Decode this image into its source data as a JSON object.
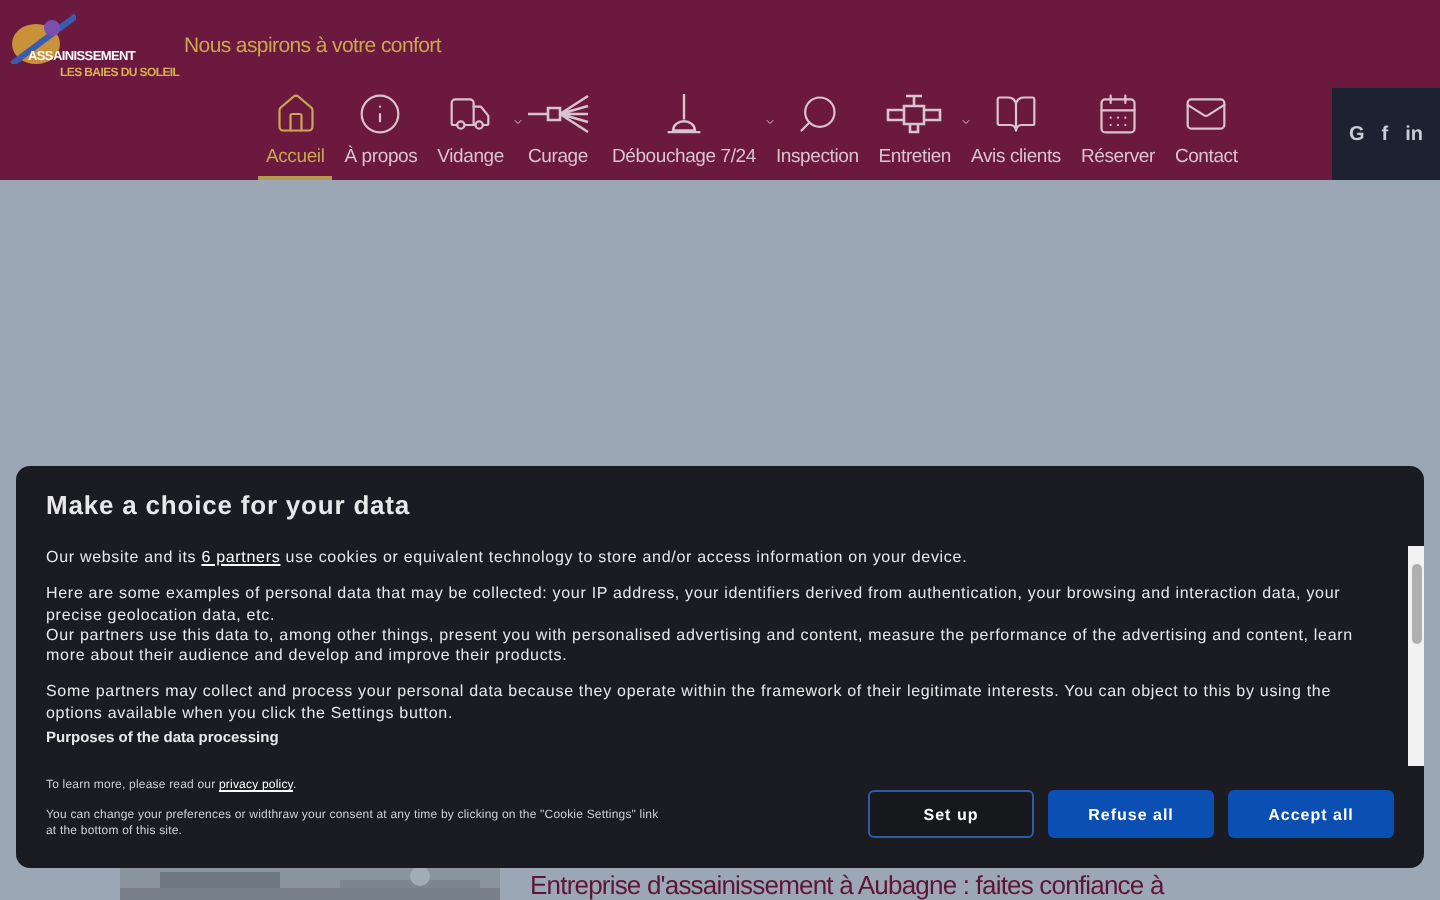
{
  "header": {
    "logo": {
      "line_1": "ASSAINISSEMENT",
      "line_2": "LES BAIES DU SOLEIL"
    },
    "tagline": "Nous aspirons à votre confort",
    "nav": [
      {
        "label": "Accueil",
        "kind": "home",
        "selected": true,
        "dropdown": false
      },
      {
        "label": "À propos",
        "kind": "info",
        "selected": false,
        "dropdown": false
      },
      {
        "label": "Vidange",
        "kind": "truck",
        "selected": false,
        "dropdown": true
      },
      {
        "label": "Curage",
        "kind": "spray",
        "selected": false,
        "dropdown": false
      },
      {
        "label": "Débouchage 7/24",
        "kind": "plunger",
        "selected": false,
        "dropdown": true
      },
      {
        "label": "Inspection",
        "kind": "search",
        "selected": false,
        "dropdown": false
      },
      {
        "label": "Entretien",
        "kind": "valve",
        "selected": false,
        "dropdown": true
      },
      {
        "label": "Avis clients",
        "kind": "book",
        "selected": false,
        "dropdown": false
      },
      {
        "label": "Réserver",
        "kind": "calendar",
        "selected": false,
        "dropdown": false
      },
      {
        "label": "Contact",
        "kind": "mail",
        "selected": false,
        "dropdown": false
      }
    ],
    "social": [
      {
        "label": "G"
      },
      {
        "label": "f"
      },
      {
        "label": "in"
      }
    ]
  },
  "content": {
    "heading": "Entreprise d'assainissement à Aubagne : faites confiance à"
  },
  "consent": {
    "title": "Make a choice for your data",
    "paragraphs": [
      {
        "before": "Our website and its ",
        "link": "6 partners",
        "after": " use cookies or equivalent technology to store and/or access information on your device."
      },
      {
        "before": "Here are some examples of personal data that may be collected: your IP address, your identifiers derived from authentication, your browsing and interaction data, your precise geolocation data, etc.\nOur partners use this data to, among other things, present you with personalised advertising and content, measure the performance of the advertising and content, learn more about their audience and develop and improve their products."
      },
      {
        "before": "Some partners may collect and process your personal data because they operate within the framework of their legitimate interests. You can object to this by using the options available when you click the Settings button."
      }
    ],
    "section_title": "Purposes of the data processing",
    "learn_more": {
      "before": "To learn more, please read our ",
      "link": "privacy policy",
      "after": "."
    },
    "footnote": "You can change your preferences or widthraw your consent at any time by clicking on the \"Cookie Settings\" link at the bottom of this site.",
    "buttons": [
      {
        "label": "Set up",
        "kind": "outline"
      },
      {
        "label": "Refuse all",
        "kind": "solid"
      },
      {
        "label": "Accept all",
        "kind": "solid"
      }
    ]
  }
}
